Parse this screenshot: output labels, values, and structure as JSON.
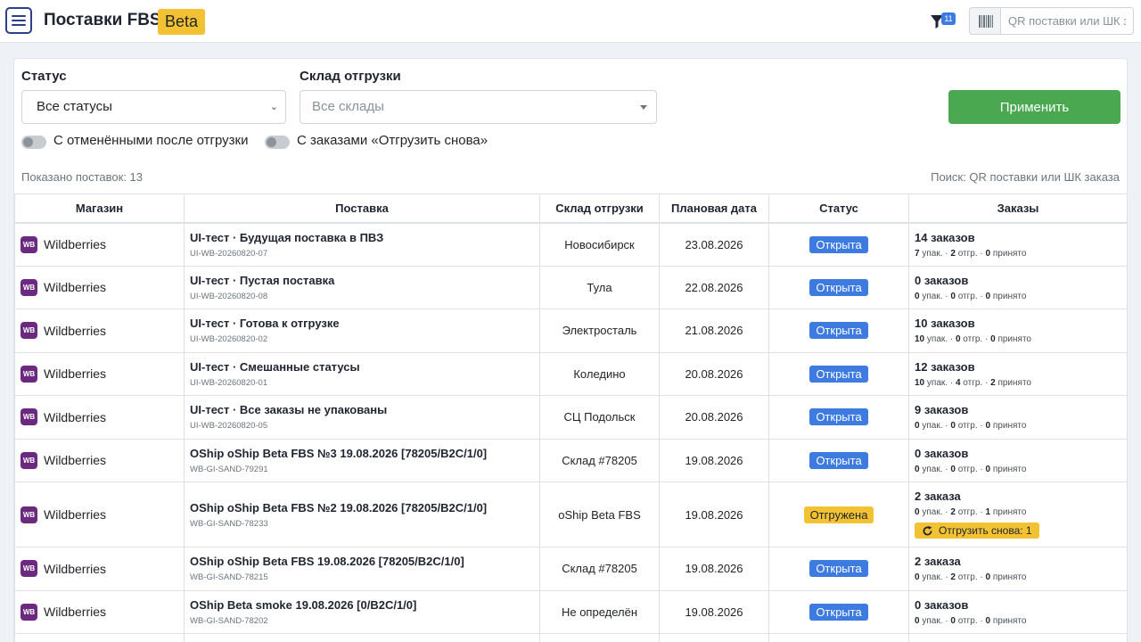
{
  "header": {
    "title": "Поставки FBS",
    "beta_label": "Beta",
    "filter_count": "11",
    "qr_placeholder": "QR поставки или ШК заказа"
  },
  "filters": {
    "status_label": "Статус",
    "status_value": "Все статусы",
    "warehouse_label": "Склад отгрузки",
    "warehouse_placeholder": "Все склады",
    "apply_label": "Применить",
    "toggle_cancelled_label": "С отменёнными после отгрузки",
    "toggle_reship_label": "С заказами «Отгрузить снова»"
  },
  "summary": {
    "shown_text": "Показано поставок: 13",
    "search_hint": "Поиск: QR поставки или ШК заказа"
  },
  "table": {
    "headers": [
      "Магазин",
      "Поставка",
      "Склад отгрузки",
      "Плановая дата",
      "Статус",
      "Заказы"
    ],
    "rows": [
      {
        "shop": "Wildberries",
        "shop_icon": "WB",
        "name": "UI-тест · Будущая поставка в ПВЗ",
        "id": "UI-WB-20260820-07",
        "warehouse": "Новосибирск",
        "date": "23.08.2026",
        "status": "Открыта",
        "orders": "14 заказов",
        "packed": "7",
        "shipped": "2",
        "accepted": "0"
      },
      {
        "shop": "Wildberries",
        "shop_icon": "WB",
        "name": "UI-тест · Пустая поставка",
        "id": "UI-WB-20260820-08",
        "warehouse": "Тула",
        "date": "22.08.2026",
        "status": "Открыта",
        "orders": "0 заказов",
        "packed": "0",
        "shipped": "0",
        "accepted": "0"
      },
      {
        "shop": "Wildberries",
        "shop_icon": "WB",
        "name": "UI-тест · Готова к отгрузке",
        "id": "UI-WB-20260820-02",
        "warehouse": "Электросталь",
        "date": "21.08.2026",
        "status": "Открыта",
        "orders": "10 заказов",
        "packed": "10",
        "shipped": "0",
        "accepted": "0"
      },
      {
        "shop": "Wildberries",
        "shop_icon": "WB",
        "name": "UI-тест · Смешанные статусы",
        "id": "UI-WB-20260820-01",
        "warehouse": "Коледино",
        "date": "20.08.2026",
        "status": "Открыта",
        "orders": "12 заказов",
        "packed": "10",
        "shipped": "4",
        "accepted": "2"
      },
      {
        "shop": "Wildberries",
        "shop_icon": "WB",
        "name": "UI-тест · Все заказы не упакованы",
        "id": "UI-WB-20260820-05",
        "warehouse": "СЦ Подольск",
        "date": "20.08.2026",
        "status": "Открыта",
        "orders": "9 заказов",
        "packed": "0",
        "shipped": "0",
        "accepted": "0"
      },
      {
        "shop": "Wildberries",
        "shop_icon": "WB",
        "name": "OShip oShip Beta FBS №3 19.08.2026 [78205/B2C/1/0]",
        "id": "WB-GI-SAND-79291",
        "warehouse": "Склад #78205",
        "date": "19.08.2026",
        "status": "Открыта",
        "orders": "0 заказов",
        "packed": "0",
        "shipped": "0",
        "accepted": "0"
      },
      {
        "shop": "Wildberries",
        "shop_icon": "WB",
        "name": "OShip oShip Beta FBS №2 19.08.2026 [78205/B2C/1/0]",
        "id": "WB-GI-SAND-78233",
        "warehouse": "oShip Beta FBS",
        "date": "19.08.2026",
        "status": "Отгружена",
        "orders": "2 заказа",
        "packed": "0",
        "shipped": "2",
        "accepted": "1",
        "reship": "Отгрузить снова: 1"
      },
      {
        "shop": "Wildberries",
        "shop_icon": "WB",
        "name": "OShip oShip Beta FBS 19.08.2026 [78205/B2C/1/0]",
        "id": "WB-GI-SAND-78215",
        "warehouse": "Склад #78205",
        "date": "19.08.2026",
        "status": "Открыта",
        "orders": "2 заказа",
        "packed": "0",
        "shipped": "2",
        "accepted": "0"
      },
      {
        "shop": "Wildberries",
        "shop_icon": "WB",
        "name": "OShip Beta smoke 19.08.2026 [0/B2C/1/0]",
        "id": "WB-GI-SAND-78202",
        "warehouse": "Не определён",
        "date": "19.08.2026",
        "status": "Открыта",
        "orders": "0 заказов",
        "packed": "0",
        "shipped": "0",
        "accepted": "0"
      }
    ],
    "labels": {
      "packed": "упак.",
      "shipped": "отгр.",
      "accepted": "принято"
    }
  },
  "colors": {
    "accent": "#3d7be0",
    "success": "#4aa851",
    "warning": "#f2c233",
    "wb_brand": "#6b2a7f"
  }
}
